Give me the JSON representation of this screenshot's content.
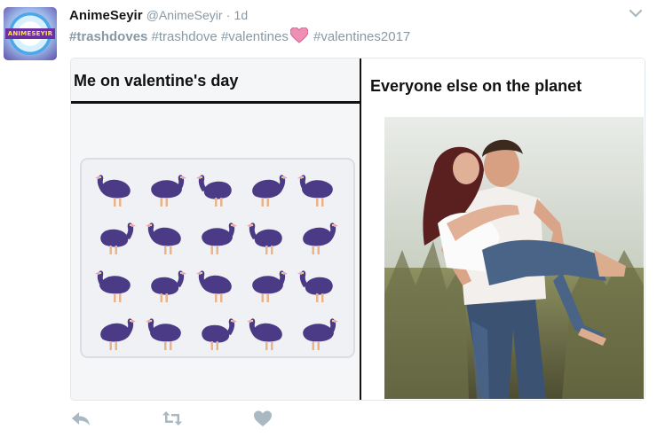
{
  "tweet": {
    "display_name": "AnimeSeyir",
    "handle": "@AnimeSeyir",
    "separator": "·",
    "time": "1d",
    "hashtags": {
      "tag1": "#trashdoves",
      "tag2": "#trashdove",
      "tag3": "#valentines",
      "tag4": "#valentines2017"
    },
    "emoji": "pink-heart-emoji",
    "avatar_icon": "animeseyir-logo-icon",
    "avatar_text": "ANIMESEYIR"
  },
  "meme": {
    "left_caption": "Me on valentine's day",
    "right_caption": "Everyone else on the planet",
    "sticker_rows": 4,
    "sticker_cols": 5,
    "sticker_icon": "purple-pigeon-icon",
    "photo_icon": "couple-photo"
  },
  "actions": {
    "reply_icon": "reply-icon",
    "retweet_icon": "retweet-icon",
    "like_icon": "heart-icon",
    "menu_icon": "chevron-down-icon"
  },
  "colors": {
    "muted_text": "#8899a6",
    "bird_body": "#4b3a86",
    "bird_legs": "#e9b48a",
    "emoji_pink": "#f08fb5",
    "action_gray": "#aab8c2"
  }
}
